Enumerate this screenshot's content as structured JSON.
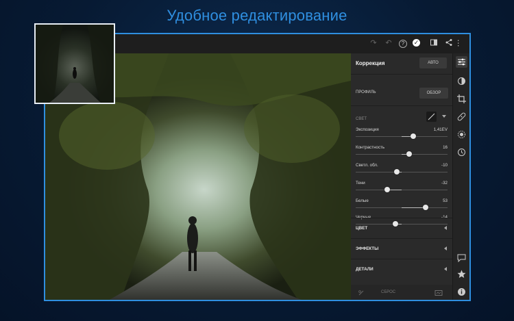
{
  "headline": "Удобное редактирование",
  "topbar": {
    "icons": [
      "redo-icon",
      "undo-icon",
      "help-icon",
      "checkmark-icon",
      "compare-icon",
      "share-icon",
      "more-icon"
    ]
  },
  "panel": {
    "title": "Коррекция",
    "auto_label": "АВТО",
    "profile_label": "ПРОФИЛЬ",
    "browse_label": "ОБЗОР",
    "light_label": "СВЕТ",
    "sliders": [
      {
        "label": "Экспозиция",
        "value": "1,41EV",
        "pos": 0.63
      },
      {
        "label": "Контрастность",
        "value": "16",
        "pos": 0.58
      },
      {
        "label": "Светл. обл.",
        "value": "-10",
        "pos": 0.45
      },
      {
        "label": "Тени",
        "value": "-32",
        "pos": 0.34
      },
      {
        "label": "Белые",
        "value": "53",
        "pos": 0.76
      },
      {
        "label": "Черные",
        "value": "-14",
        "pos": 0.43
      }
    ],
    "sections": [
      "ЦВЕТ",
      "ЭФФЕКТЫ",
      "ДЕТАЛИ"
    ],
    "reset_label": "СБРОС"
  },
  "toolstrip": {
    "icons": [
      "edit-sliders-icon",
      "presets-icon",
      "crop-icon",
      "healing-brush-icon",
      "selective-icon",
      "history-icon",
      "comments-icon",
      "rating-star-icon",
      "info-icon"
    ]
  },
  "colors": {
    "accent": "#2f8fe0",
    "panel": "#2a2a2a",
    "background": "#071a33"
  }
}
